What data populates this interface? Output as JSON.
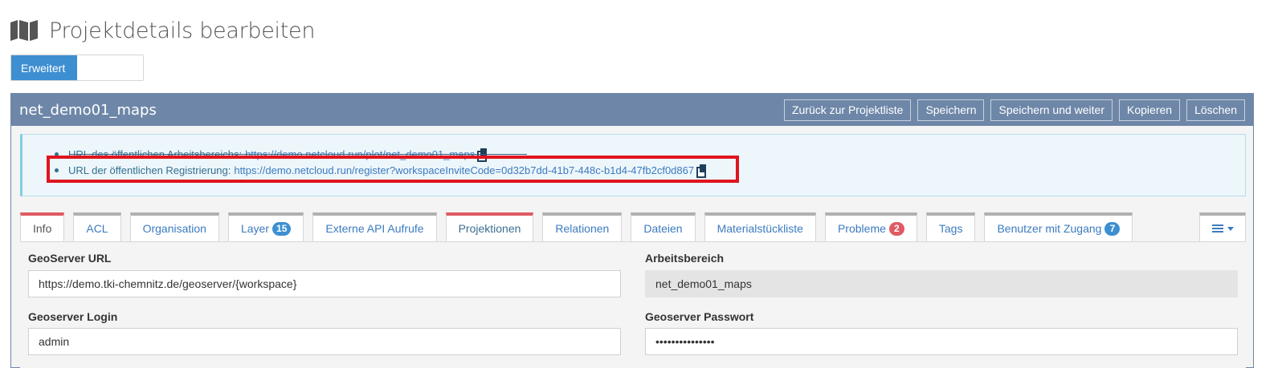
{
  "header": {
    "title": "Projektdetails bearbeiten",
    "icon": "map-icon"
  },
  "view_toggle": {
    "active_label": "Erweitert",
    "inactive_label": ""
  },
  "panel": {
    "title": "net_demo01_maps",
    "actions": [
      "Zurück zur Projektliste",
      "Speichern",
      "Speichern und weiter",
      "Kopieren",
      "Löschen"
    ]
  },
  "info": {
    "items": [
      {
        "label": "URL des öffentlichen Arbeitsbereichs:",
        "link": "https://demo.netcloud.run/plot/net_demo01_maps"
      },
      {
        "label": "URL der öffentlichen Registrierung:",
        "link": "https://demo.netcloud.run/register?workspaceInviteCode=0d32b7dd-41b7-448c-b1d4-47fb2cf0d867"
      }
    ]
  },
  "tabs": [
    {
      "label": "Info",
      "badge": null
    },
    {
      "label": "ACL",
      "badge": null
    },
    {
      "label": "Organisation",
      "badge": null
    },
    {
      "label": "Layer",
      "badge": "15"
    },
    {
      "label": "Externe API Aufrufe",
      "badge": null
    },
    {
      "label": "Projektionen",
      "badge": null
    },
    {
      "label": "Relationen",
      "badge": null
    },
    {
      "label": "Dateien",
      "badge": null
    },
    {
      "label": "Materialstückliste",
      "badge": null
    },
    {
      "label": "Probleme",
      "badge": "2"
    },
    {
      "label": "Tags",
      "badge": null
    },
    {
      "label": "Benutzer mit Zugang",
      "badge": "7"
    }
  ],
  "form": {
    "geoserver_url": {
      "label": "GeoServer URL",
      "value": "https://demo.tki-chemnitz.de/geoserver/{workspace}"
    },
    "workspace": {
      "label": "Arbeitsbereich",
      "value": "net_demo01_maps"
    },
    "login": {
      "label": "Geoserver Login",
      "value": "admin"
    },
    "password": {
      "label": "Geoserver Passwort",
      "value": "•••••••••••••••"
    }
  },
  "colors": {
    "accent": "#3d8fd1",
    "panel_header": "#6e87a8",
    "highlight": "#e0141e",
    "badge_red": "#e05a63"
  }
}
